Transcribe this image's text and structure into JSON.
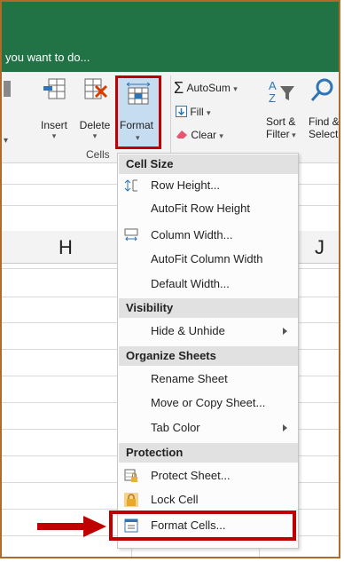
{
  "tell_me": "you want to do...",
  "ribbon": {
    "insert": "Insert",
    "delete": "Delete",
    "format": "Format",
    "cells_group": "Cells",
    "autosum": "AutoSum",
    "fill": "Fill",
    "clear": "Clear",
    "sort_filter_line1": "Sort &",
    "sort_filter_line2": "Filter",
    "find_line1": "Find &",
    "find_line2": "Select"
  },
  "columns": {
    "h": "H",
    "j": "J"
  },
  "menu": {
    "cell_size_header": "Cell Size",
    "row_height": "Row Height...",
    "autofit_row": "AutoFit Row Height",
    "column_width": "Column Width...",
    "autofit_column": "AutoFit Column Width",
    "default_width": "Default Width...",
    "visibility_header": "Visibility",
    "hide_unhide": "Hide & Unhide",
    "organize_header": "Organize Sheets",
    "rename_sheet": "Rename Sheet",
    "move_copy": "Move or Copy Sheet...",
    "tab_color": "Tab Color",
    "protection_header": "Protection",
    "protect_sheet": "Protect Sheet...",
    "lock_cell": "Lock Cell",
    "format_cells": "Format Cells..."
  },
  "colors": {
    "excel_green": "#217346",
    "highlight_red": "#c00000"
  }
}
